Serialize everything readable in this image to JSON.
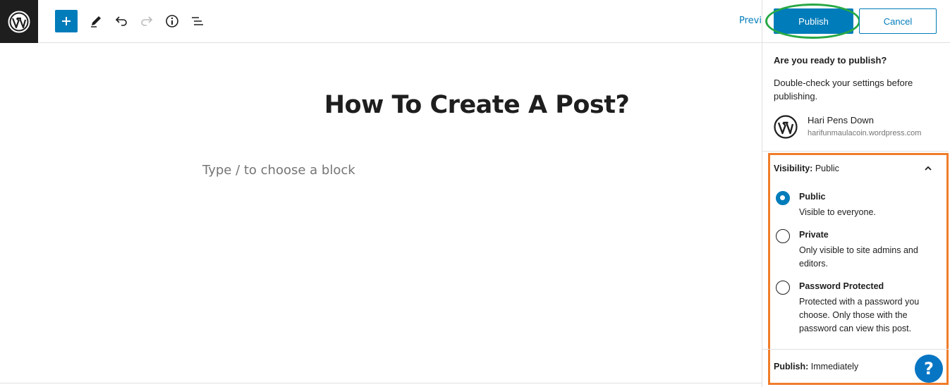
{
  "toolbar": {
    "add_block": "+",
    "preview_label": "Previe"
  },
  "editor": {
    "title": "How To Create A Post?",
    "block_placeholder": "Type / to choose a block"
  },
  "publish_panel": {
    "publish_label": "Publish",
    "cancel_label": "Cancel",
    "ready_heading": "Are you ready to publish?",
    "ready_description": "Double-check your settings before publishing.",
    "site_name": "Hari Pens Down",
    "site_url": "harifunmaulacoin.wordpress.com",
    "visibility": {
      "label": "Visibility:",
      "value": "Public",
      "options": [
        {
          "label": "Public",
          "description": "Visible to everyone.",
          "checked": true
        },
        {
          "label": "Private",
          "description": "Only visible to site admins and editors.",
          "checked": false
        },
        {
          "label": "Password Protected",
          "description": "Protected with a password you choose. Only those with the password can view this post.",
          "checked": false
        }
      ]
    },
    "publish_time": {
      "label": "Publish:",
      "value": "Immediately"
    },
    "help_label": "?"
  },
  "colors": {
    "accent": "#007cba",
    "highlight_ring": "#27a844",
    "highlight_box": "#f07c2a"
  },
  "icons": [
    "wordpress-logo-icon",
    "plus-icon",
    "pencil-icon",
    "undo-icon",
    "redo-icon",
    "info-icon",
    "list-view-icon",
    "chevron-up-icon",
    "help-icon"
  ]
}
